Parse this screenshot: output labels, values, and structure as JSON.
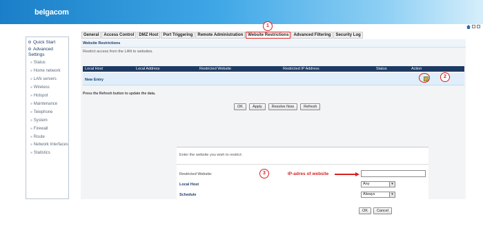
{
  "brand": {
    "logo": "belgacom"
  },
  "sidebar": {
    "main": [
      {
        "label": "Quick Start"
      },
      {
        "label": "Advanced Settings"
      }
    ],
    "items": [
      {
        "label": "Status"
      },
      {
        "label": "Home network"
      },
      {
        "label": "LAN servers"
      },
      {
        "label": "Wireless"
      },
      {
        "label": "Hotspot"
      },
      {
        "label": "Maintenance"
      },
      {
        "label": "Telephone"
      },
      {
        "label": "System"
      },
      {
        "label": "Firewall"
      },
      {
        "label": "Route"
      },
      {
        "label": "Network Interfaces"
      },
      {
        "label": "Statistics"
      }
    ]
  },
  "tabs": [
    {
      "label": "General"
    },
    {
      "label": "Access Control"
    },
    {
      "label": "DMZ Host"
    },
    {
      "label": "Port Triggering"
    },
    {
      "label": "Remote Administration"
    },
    {
      "label": "Website Restrictions",
      "active": true
    },
    {
      "label": "Advanced Filtering"
    },
    {
      "label": "Security Log"
    }
  ],
  "content": {
    "subtab": "Website Restrictions",
    "description": "Restrict access from the LAN to websites.",
    "table": {
      "headers": [
        "Local Host",
        "Local Address",
        "Restricted Website",
        "Restricted IP Address",
        "Status",
        "Action"
      ],
      "new_entry": "New Entry"
    },
    "refresh_note": "Press the Refresh button to update the data.",
    "buttons": {
      "ok": "OK",
      "apply": "Apply",
      "resolve_now": "Resolve Now",
      "refresh": "Refresh"
    }
  },
  "callouts": {
    "one": "1",
    "two": "2",
    "three": "3"
  },
  "dialog": {
    "prompt": "Enter the website you wish to restrict:",
    "restricted_website_label": "Restricted Website:",
    "restricted_website_value": "",
    "annotation": "IP-adres of website",
    "local_host_label": "Local Host",
    "local_host_value": "Any",
    "schedule_label": "Schedule",
    "schedule_value": "Always",
    "ok": "OK",
    "cancel": "Cancel"
  },
  "colors": {
    "accent": "#d81f1f",
    "header_blue": "#1a7fc8",
    "table_header": "#1d3a64",
    "row_bg": "#dfeefa"
  },
  "icons": [
    "home-icon",
    "edit-entry-icon",
    "dropdown-caret-icon",
    "bullet-dot-icon"
  ]
}
